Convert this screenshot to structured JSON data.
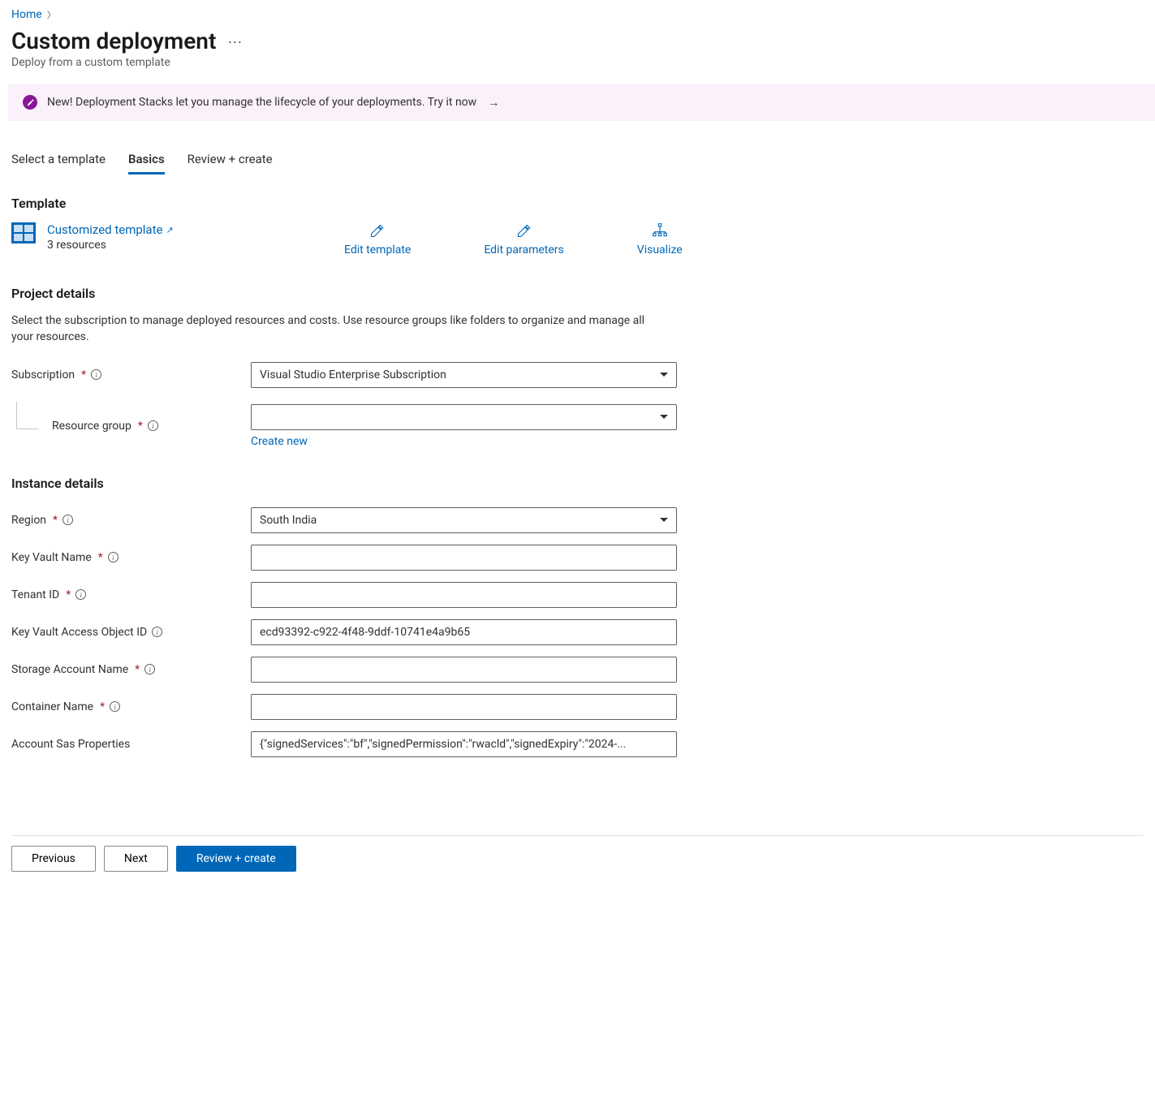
{
  "breadcrumb": {
    "home": "Home"
  },
  "page": {
    "title": "Custom deployment",
    "subtitle": "Deploy from a custom template"
  },
  "banner": {
    "text": "New! Deployment Stacks let you manage the lifecycle of your deployments. Try it now"
  },
  "tabs": {
    "select_template": "Select a template",
    "basics": "Basics",
    "review_create": "Review + create"
  },
  "template": {
    "heading": "Template",
    "link": "Customized template",
    "resources": "3 resources",
    "actions": {
      "edit_template": "Edit template",
      "edit_parameters": "Edit parameters",
      "visualize": "Visualize"
    }
  },
  "project": {
    "heading": "Project details",
    "description": "Select the subscription to manage deployed resources and costs. Use resource groups like folders to organize and manage all your resources.",
    "subscription_label": "Subscription",
    "subscription_value": "Visual Studio Enterprise Subscription",
    "resource_group_label": "Resource group",
    "resource_group_value": "",
    "create_new": "Create new"
  },
  "instance": {
    "heading": "Instance details",
    "region_label": "Region",
    "region_value": "South India",
    "kv_name_label": "Key Vault Name",
    "kv_name_value": "",
    "tenant_label": "Tenant ID",
    "tenant_value": "",
    "kv_obj_label": "Key Vault Access Object ID",
    "kv_obj_value": "ecd93392-c922-4f48-9ddf-10741e4a9b65",
    "storage_label": "Storage Account Name",
    "storage_value": "",
    "container_label": "Container Name",
    "container_value": "",
    "sas_label": "Account Sas Properties",
    "sas_value": "{\"signedServices\":\"bf\",\"signedPermission\":\"rwacld\",\"signedExpiry\":\"2024-..."
  },
  "footer": {
    "previous": "Previous",
    "next": "Next",
    "review_create": "Review + create"
  }
}
